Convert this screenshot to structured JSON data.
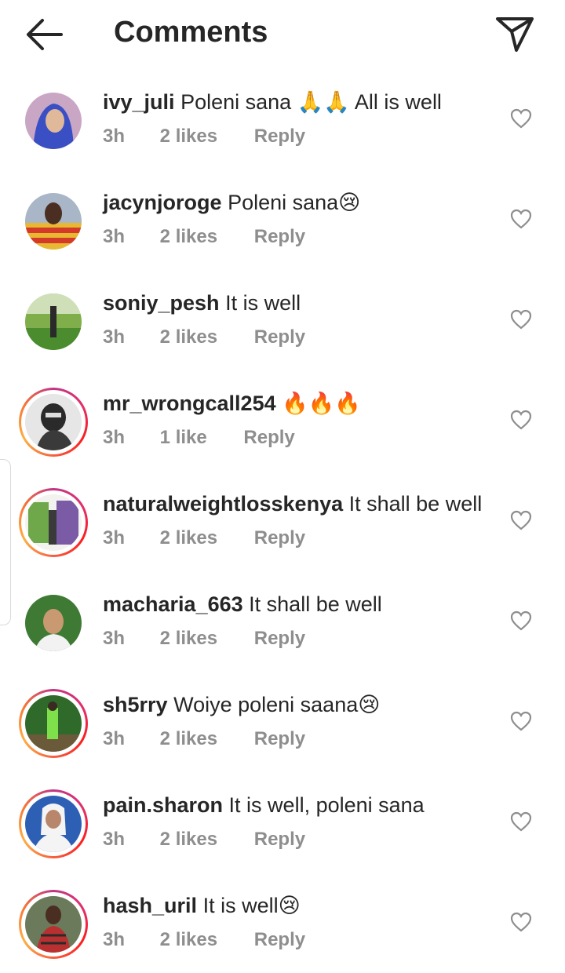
{
  "header": {
    "title": "Comments",
    "back_icon": "arrow-left-icon",
    "share_icon": "paper-plane-icon"
  },
  "comments": [
    {
      "username": "ivy_juli",
      "text": "Poleni sana 🙏🙏 All is well",
      "time": "3h",
      "likes": "2 likes",
      "reply": "Reply",
      "avatar_color": "#3a4fc4"
    },
    {
      "username": "jacynjoroge",
      "text": "Poleni sana😢",
      "time": "3h",
      "likes": "2 likes",
      "reply": "Reply",
      "avatar_color": "#e8b830"
    },
    {
      "username": "soniy_pesh",
      "text": "It is well",
      "time": "3h",
      "likes": "2 likes",
      "reply": "Reply",
      "avatar_color": "#4a8c2e"
    },
    {
      "username": "mr_wrongcall254",
      "text": "🔥🔥🔥",
      "time": "3h",
      "likes": "1 like",
      "reply": "Reply",
      "avatar_color": "#555555"
    },
    {
      "username": "naturalweightlosskenya",
      "text": "It shall be well",
      "time": "3h",
      "likes": "2 likes",
      "reply": "Reply",
      "avatar_color": "#6fa84a"
    },
    {
      "username": "macharia_663",
      "text": "It shall be well",
      "time": "3h",
      "likes": "2 likes",
      "reply": "Reply",
      "avatar_color": "#3e7a34"
    },
    {
      "username": "sh5rry",
      "text": "Woiye poleni saana😢",
      "time": "3h",
      "likes": "2 likes",
      "reply": "Reply",
      "avatar_color": "#2f6a2a"
    },
    {
      "username": "pain.sharon",
      "text": "It is well, poleni sana",
      "time": "3h",
      "likes": "2 likes",
      "reply": "Reply",
      "avatar_color": "#2d5fb5"
    },
    {
      "username": "hash_uril",
      "text": "It is well😢",
      "time": "3h",
      "likes": "2 likes",
      "reply": "Reply",
      "avatar_color": "#8a2a2a"
    }
  ],
  "colors": {
    "text": "#262626",
    "meta": "#8e8e8e",
    "story_ring": "#e1306c",
    "fire": "#f05a1a"
  }
}
